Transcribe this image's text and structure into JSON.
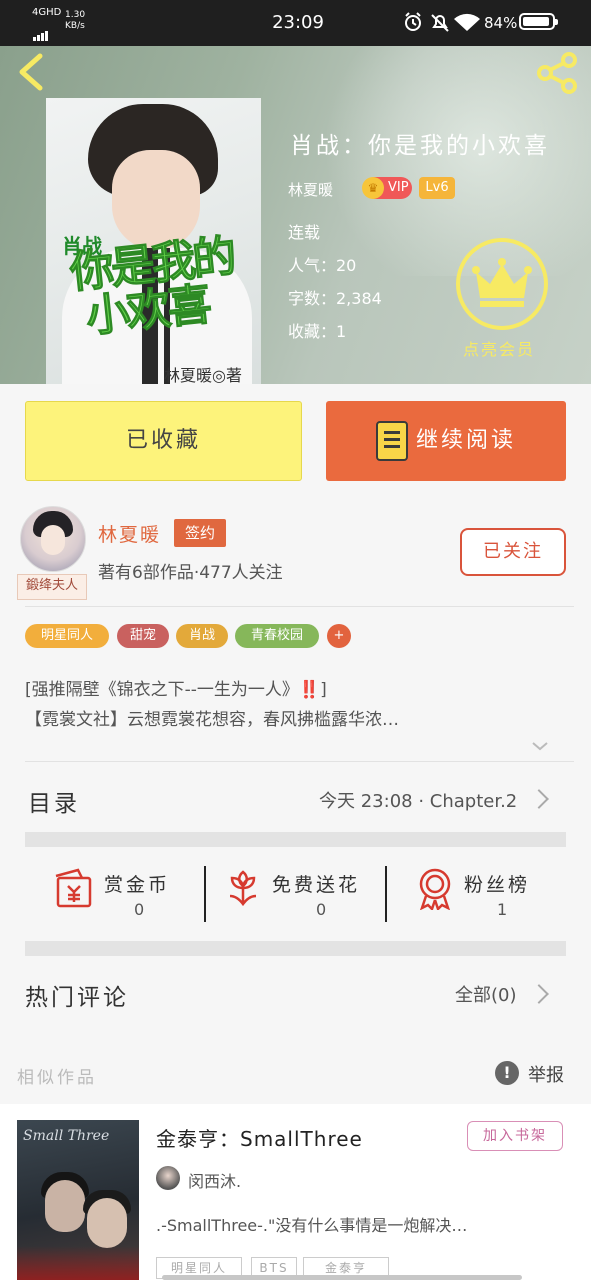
{
  "status_bar": {
    "network": "4GHD",
    "speed": "1.30\nKB/s",
    "time": "23:09",
    "icons": [
      "alarm-icon",
      "mute-icon",
      "wifi-icon"
    ],
    "battery": "84%",
    "battery_level": 0.84
  },
  "book": {
    "title": "肖战：你是我的小欢喜",
    "author": "林夏暖",
    "vip": "VIP",
    "level": "Lv6",
    "status": "连载",
    "popularity": "人气：20",
    "word_count": "字数：2,384",
    "collections": "收藏：1",
    "cover": {
      "line1": "肖战",
      "line2": "你是我的",
      "line3": "小欢喜",
      "author_mark": "林夏暖◎著"
    },
    "member_label": "点亮会员"
  },
  "actions": {
    "favorited": "已收藏",
    "continue_reading": "继续阅读"
  },
  "author": {
    "name": "林夏暖",
    "signed": "签约",
    "stats": "著有6部作品·477人关注",
    "follow": "已关注",
    "avatar_badge": "鍛绛夫人"
  },
  "tags": [
    {
      "label": "明星同人",
      "color": "#f2ae3c"
    },
    {
      "label": "甜宠",
      "color": "#c9615f"
    },
    {
      "label": "肖战",
      "color": "#e3a93a"
    },
    {
      "label": "青春校园",
      "color": "#86b75a"
    },
    {
      "label": "+",
      "color": "#e2633e"
    }
  ],
  "description": {
    "line1_before": "[强推隔壁《锦衣之下--一生为一人》",
    "line1_mark": "‼️",
    "line1_after": "]",
    "line2": "【霓裳文社】云想霓裳花想容，春风拂槛露华浓…"
  },
  "toc": {
    "label": "目录",
    "latest": "今天 23:08 · Chapter.2"
  },
  "gifts": [
    {
      "name": "赏金币",
      "count": "0",
      "icon": "money-envelope-icon"
    },
    {
      "name": "免费送花",
      "count": "0",
      "icon": "flower-icon"
    },
    {
      "name": "粉丝榜",
      "count": "1",
      "icon": "medal-icon"
    }
  ],
  "comments": {
    "label": "热门评论",
    "all": "全部(0)"
  },
  "similar": {
    "label": "相似作品",
    "report": "举报",
    "item": {
      "title": "金泰亨：SmallThree",
      "add_shelf": "加入书架",
      "author": "闵西沐.",
      "desc": ".-SmallThree-.\"没有什么事情是一炮解决…",
      "cover_title": "Small Three",
      "tags": [
        "明星同人",
        "BTS",
        "金泰亨"
      ]
    }
  },
  "colors": {
    "accent": "#ea6a3e",
    "favorite_bg": "#fdf37b",
    "crown": "#f7ea63"
  }
}
